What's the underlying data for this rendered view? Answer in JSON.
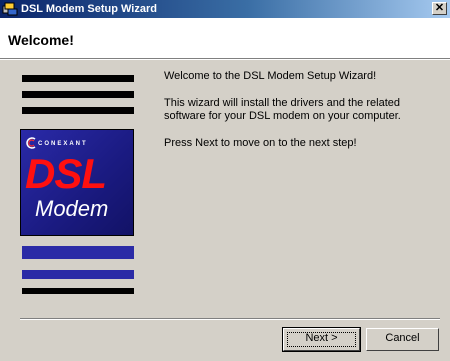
{
  "window": {
    "title": "DSL Modem Setup Wizard",
    "close_glyph": "✕"
  },
  "header": {
    "title": "Welcome!"
  },
  "logo": {
    "brand": "CONEXANT",
    "product": "DSL",
    "product_sub": "Modem"
  },
  "content": {
    "paragraphs": [
      "Welcome to the DSL Modem Setup Wizard!",
      "This wizard will install the drivers and the related software for your DSL modem on your computer.",
      "Press Next to move on to the next step!"
    ]
  },
  "buttons": {
    "next": "Next >",
    "cancel": "Cancel"
  },
  "colors": {
    "titlebar": "#0a246a",
    "dsl_red": "#ff1010",
    "logo_blue": "#1a1a80"
  }
}
